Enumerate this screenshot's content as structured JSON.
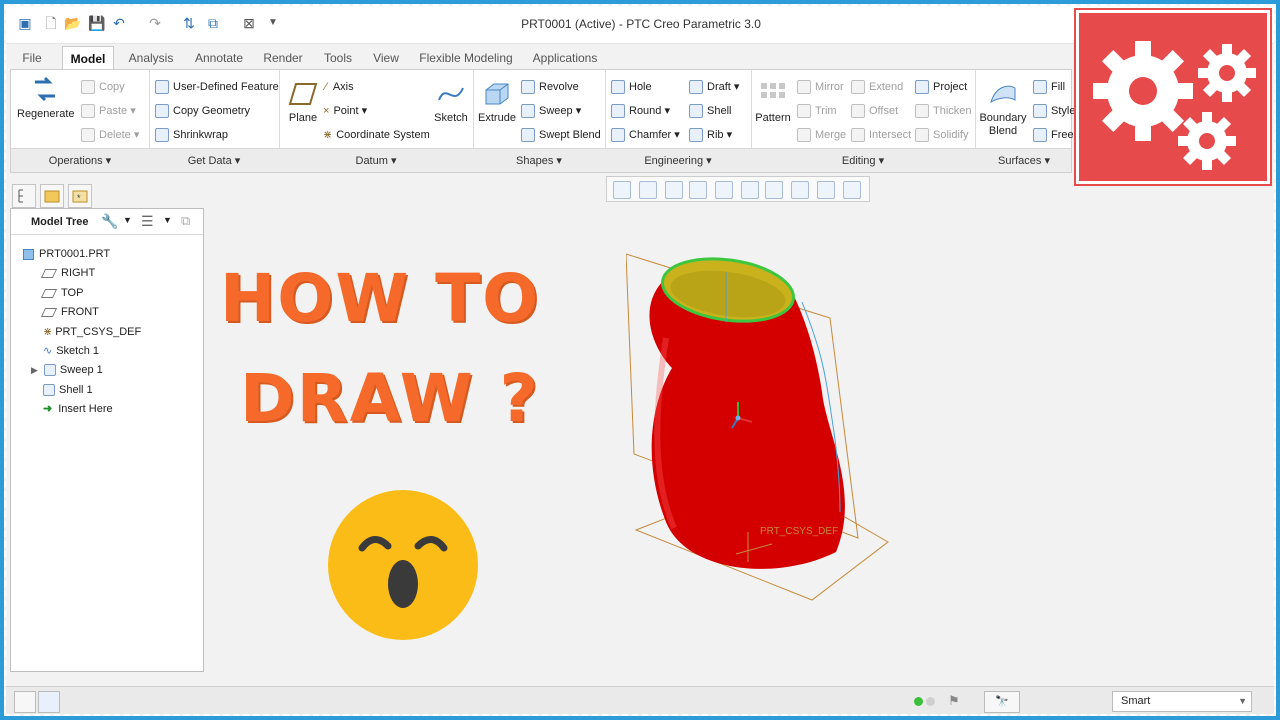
{
  "window": {
    "title": "PRT0001 (Active) - PTC Creo Parametric 3.0"
  },
  "tabs": [
    "File",
    "Model",
    "Analysis",
    "Annotate",
    "Render",
    "Tools",
    "View",
    "Flexible Modeling",
    "Applications"
  ],
  "ribbon": {
    "regenerate": "Regenerate",
    "operations": {
      "copy": "Copy",
      "paste": "Paste",
      "delete": "Delete",
      "label": "Operations"
    },
    "getdata": {
      "udf": "User-Defined Feature",
      "copygeom": "Copy Geometry",
      "shrinkwrap": "Shrinkwrap",
      "label": "Get Data"
    },
    "datum": {
      "plane": "Plane",
      "axis": "Axis",
      "point": "Point",
      "csys": "Coordinate System",
      "sketch": "Sketch",
      "label": "Datum"
    },
    "shapes": {
      "extrude": "Extrude",
      "revolve": "Revolve",
      "sweep": "Sweep",
      "swept_blend": "Swept Blend",
      "label": "Shapes"
    },
    "engineering": {
      "hole": "Hole",
      "round": "Round",
      "chamfer": "Chamfer",
      "draft": "Draft",
      "shell": "Shell",
      "rib": "Rib",
      "label": "Engineering"
    },
    "editing": {
      "pattern": "Pattern",
      "mirror": "Mirror",
      "trim": "Trim",
      "merge": "Merge",
      "extend": "Extend",
      "offset": "Offset",
      "intersect": "Intersect",
      "project": "Project",
      "thicken": "Thicken",
      "solidify": "Solidify",
      "label": "Editing"
    },
    "surfaces": {
      "boundary_blend_1": "Boundary",
      "boundary_blend_2": "Blend",
      "fill": "Fill",
      "style": "Style",
      "freestyle": "Frees",
      "label": "Surfaces"
    }
  },
  "model_tree": {
    "header": "Model Tree",
    "items": [
      "PRT0001.PRT",
      "RIGHT",
      "TOP",
      "FRONT",
      "PRT_CSYS_DEF",
      "Sketch 1",
      "Sweep 1",
      "Shell 1",
      "Insert Here"
    ]
  },
  "overlay": {
    "line1": "HOW TO",
    "line2": "DRAW ?"
  },
  "viewport": {
    "csys_label": "PRT_CSYS_DEF"
  },
  "status": {
    "filter": "Smart"
  },
  "colors": {
    "accent": "#e64a4a",
    "headline": "#f56a2a",
    "part": "#d40000",
    "frame": "#2b9cd8"
  }
}
